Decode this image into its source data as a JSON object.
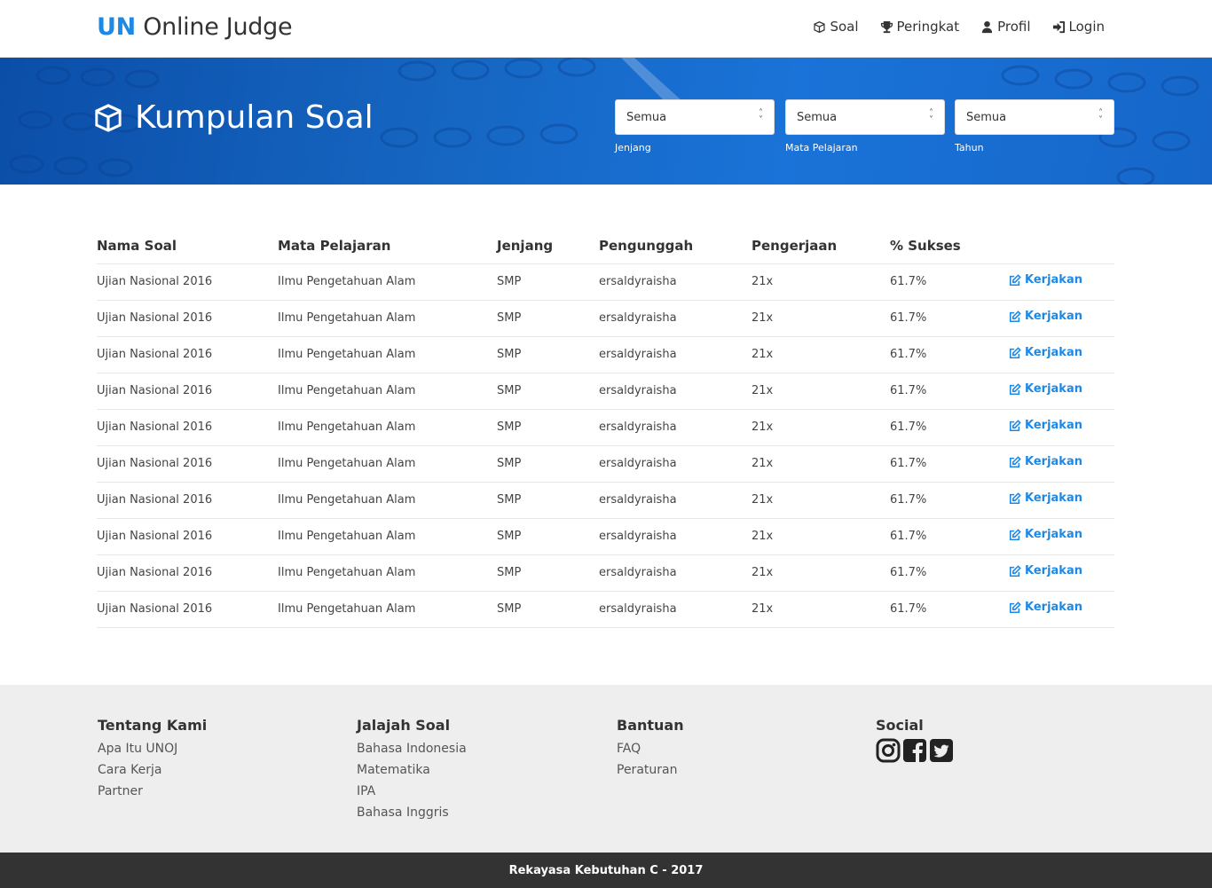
{
  "navbar": {
    "brand_un": "UN",
    "brand_rest": "Online Judge",
    "items": [
      {
        "label": "Soal",
        "icon": "cube-icon"
      },
      {
        "label": "Peringkat",
        "icon": "trophy-icon"
      },
      {
        "label": "Profil",
        "icon": "user-icon"
      },
      {
        "label": "Login",
        "icon": "sign-in-icon"
      }
    ]
  },
  "hero": {
    "title": "Kumpulan Soal",
    "filters": [
      {
        "value": "Semua",
        "label": "Jenjang"
      },
      {
        "value": "Semua",
        "label": "Mata Pelajaran"
      },
      {
        "value": "Semua",
        "label": "Tahun"
      }
    ]
  },
  "table": {
    "headers": [
      "Nama Soal",
      "Mata Pelajaran",
      "Jenjang",
      "Pengunggah",
      "Pengerjaan",
      "% Sukses",
      ""
    ],
    "action_label": "Kerjakan",
    "rows": [
      {
        "nama": "Ujian Nasional 2016",
        "mapel": "Ilmu Pengetahuan Alam",
        "jenjang": "SMP",
        "pengunggah": "ersaldyraisha",
        "pengerjaan": "21x",
        "sukses": "61.7%"
      },
      {
        "nama": "Ujian Nasional 2016",
        "mapel": "Ilmu Pengetahuan Alam",
        "jenjang": "SMP",
        "pengunggah": "ersaldyraisha",
        "pengerjaan": "21x",
        "sukses": "61.7%"
      },
      {
        "nama": "Ujian Nasional 2016",
        "mapel": "Ilmu Pengetahuan Alam",
        "jenjang": "SMP",
        "pengunggah": "ersaldyraisha",
        "pengerjaan": "21x",
        "sukses": "61.7%"
      },
      {
        "nama": "Ujian Nasional 2016",
        "mapel": "Ilmu Pengetahuan Alam",
        "jenjang": "SMP",
        "pengunggah": "ersaldyraisha",
        "pengerjaan": "21x",
        "sukses": "61.7%"
      },
      {
        "nama": "Ujian Nasional 2016",
        "mapel": "Ilmu Pengetahuan Alam",
        "jenjang": "SMP",
        "pengunggah": "ersaldyraisha",
        "pengerjaan": "21x",
        "sukses": "61.7%"
      },
      {
        "nama": "Ujian Nasional 2016",
        "mapel": "Ilmu Pengetahuan Alam",
        "jenjang": "SMP",
        "pengunggah": "ersaldyraisha",
        "pengerjaan": "21x",
        "sukses": "61.7%"
      },
      {
        "nama": "Ujian Nasional 2016",
        "mapel": "Ilmu Pengetahuan Alam",
        "jenjang": "SMP",
        "pengunggah": "ersaldyraisha",
        "pengerjaan": "21x",
        "sukses": "61.7%"
      },
      {
        "nama": "Ujian Nasional 2016",
        "mapel": "Ilmu Pengetahuan Alam",
        "jenjang": "SMP",
        "pengunggah": "ersaldyraisha",
        "pengerjaan": "21x",
        "sukses": "61.7%"
      },
      {
        "nama": "Ujian Nasional 2016",
        "mapel": "Ilmu Pengetahuan Alam",
        "jenjang": "SMP",
        "pengunggah": "ersaldyraisha",
        "pengerjaan": "21x",
        "sukses": "61.7%"
      },
      {
        "nama": "Ujian Nasional 2016",
        "mapel": "Ilmu Pengetahuan Alam",
        "jenjang": "SMP",
        "pengunggah": "ersaldyraisha",
        "pengerjaan": "21x",
        "sukses": "61.7%"
      }
    ]
  },
  "footer": {
    "columns": [
      {
        "title": "Tentang Kami",
        "links": [
          "Apa Itu UNOJ",
          "Cara Kerja",
          "Partner"
        ]
      },
      {
        "title": "Jalajah Soal",
        "links": [
          "Bahasa Indonesia",
          "Matematika",
          "IPA",
          "Bahasa Inggris"
        ]
      },
      {
        "title": "Bantuan",
        "links": [
          "FAQ",
          "Peraturan"
        ]
      },
      {
        "title": "Social",
        "links": []
      }
    ],
    "social": [
      "instagram-icon",
      "facebook-icon",
      "twitter-icon"
    ],
    "copyright": "Rekayasa Kebutuhan C - 2017"
  },
  "colors": {
    "accent": "#1e88e5",
    "hero": "#1565c0",
    "footer_bg": "#eeeeee",
    "bottom_bar": "#333333"
  }
}
